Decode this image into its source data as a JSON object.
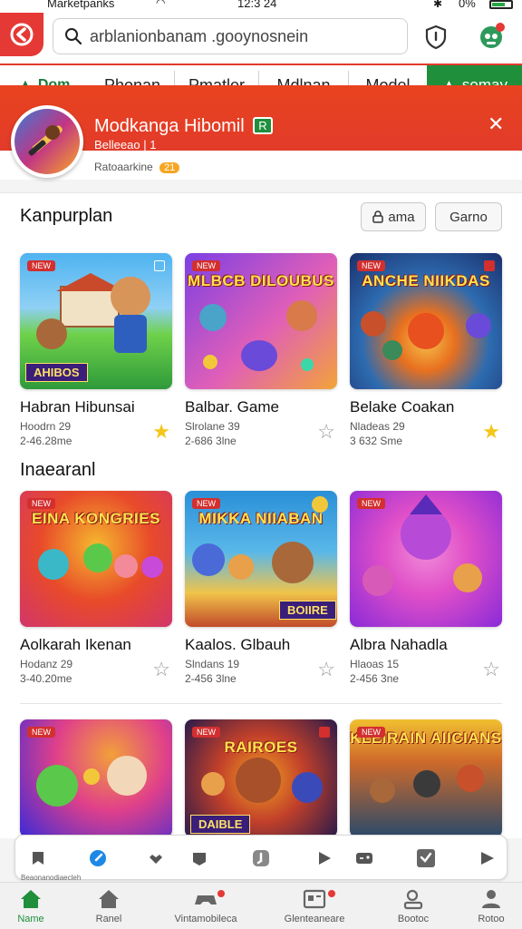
{
  "status_bar": {
    "app_name": "Marketpanks",
    "time": "12:3 24",
    "battery": "0%"
  },
  "search": {
    "value": "arblanionbanam .gooynosnein",
    "placeholder": "arblanionbanam .gooynosnein"
  },
  "tabs": {
    "home": "Dom",
    "items": [
      "Phonan",
      "Pmatler",
      "Mdlnan",
      "Model"
    ],
    "active_label": "somay"
  },
  "promo": {
    "title": "Modkanga Hibomil",
    "badge": "R",
    "subtitle": "Belleeao | 1",
    "meta": "Ratoaarkine",
    "pill": "21",
    "close_icon": "close-icon"
  },
  "section1": {
    "title": "Kanpurplan",
    "chips": [
      "ama",
      "Garno"
    ]
  },
  "section2": {
    "title": "Inaearanl"
  },
  "games": [
    {
      "title": "Habran Hibunsai",
      "line1": "Hoodrn 29",
      "line2": "2-46.28me",
      "starred": true,
      "tag": "NEW",
      "banner": "AHIBOS",
      "headline": "",
      "colors": [
        "#4fb3f0",
        "#6fd14a",
        "#2e9a3a"
      ]
    },
    {
      "title": "Balbar. Game",
      "line1": "Slrolane 39",
      "line2": "2-686 3lne",
      "starred": false,
      "tag": "NEW",
      "banner": "",
      "headline": "MLBCB DILOUBUS",
      "colors": [
        "#7b3fe4",
        "#e05fb8",
        "#f2a33a"
      ]
    },
    {
      "title": "Belake Coakan",
      "line1": "Nladeas 29",
      "line2": "3 632 Sme",
      "starred": true,
      "tag": "NEW",
      "banner": "",
      "headline": "ANCHE NIIKDAS",
      "colors": [
        "#1b2f6b",
        "#2d6bb0",
        "#e8701f"
      ]
    },
    {
      "title": "Aolkarah Ikenan",
      "line1": "Hodanz 29",
      "line2": "3-40.20me",
      "starred": false,
      "tag": "NEW",
      "banner": "",
      "headline": "EINA KONGRIES",
      "colors": [
        "#e84a2a",
        "#f5b82e",
        "#d2356a"
      ]
    },
    {
      "title": "Kaalos. Glbauh",
      "line1": "Slndans 19",
      "line2": "2-456 3lne",
      "starred": false,
      "tag": "NEW",
      "banner": "BOIIRE",
      "headline": "MIKKA NIIABAN",
      "colors": [
        "#2a8fd8",
        "#f0c44a",
        "#c24a2a"
      ]
    },
    {
      "title": "Albra Nahadla",
      "line1": "Hlaoas 15",
      "line2": "2-456 3ne",
      "starred": false,
      "tag": "NEW",
      "banner": "",
      "headline": "",
      "colors": [
        "#8a2ad8",
        "#e04fc8",
        "#f08ad8"
      ]
    },
    {
      "title": "",
      "line1": "",
      "line2": "",
      "starred": false,
      "tag": "NEW",
      "banner": "",
      "headline": "",
      "colors": [
        "#3a2ad8",
        "#e0408a",
        "#f2a03a"
      ]
    },
    {
      "title": "",
      "line1": "",
      "line2": "",
      "starred": false,
      "tag": "NEW",
      "banner": "DAIBLE",
      "headline": "RAIROES",
      "colors": [
        "#2a1a4a",
        "#c2402a",
        "#f0a020"
      ]
    },
    {
      "title": "",
      "line1": "",
      "line2": "",
      "starred": false,
      "tag": "NEW",
      "banner": "",
      "headline": "KLEIRAIN AIICIANS",
      "colors": [
        "#2a4a6a",
        "#d06a2a",
        "#f0c030"
      ]
    }
  ],
  "quickbar": {
    "label": "Beaonanodiaecleh"
  },
  "bottom_nav": [
    {
      "label": "Name",
      "icon": "home-icon",
      "active": true
    },
    {
      "label": "Ranel",
      "icon": "house-icon",
      "active": false
    },
    {
      "label": "Vintamobileca",
      "icon": "gamepad-icon",
      "active": false
    },
    {
      "label": "Glenteaneare",
      "icon": "message-board-icon",
      "active": false
    },
    {
      "label": "Bootoc",
      "icon": "profile-card-icon",
      "active": false
    },
    {
      "label": "Rotoo",
      "icon": "person-icon",
      "active": false
    }
  ],
  "colors": {
    "brand_red": "#e23b2a",
    "brand_green": "#1f8f3c",
    "star_gold": "#f5c518"
  }
}
